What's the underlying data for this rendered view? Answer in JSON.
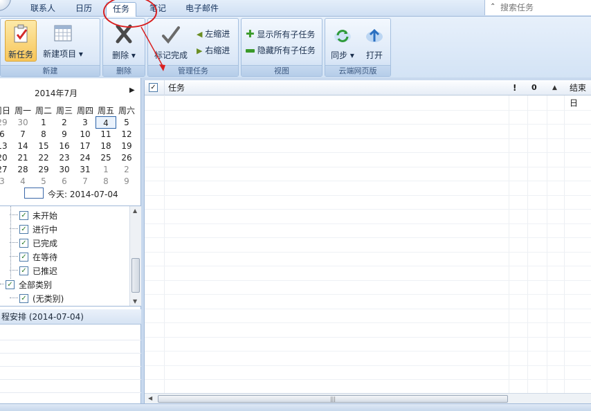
{
  "tabs": [
    "联系人",
    "日历",
    "任务",
    "笔记",
    "电子邮件"
  ],
  "active_tab": "任务",
  "search": {
    "placeholder": "搜索任务"
  },
  "ribbon": {
    "new_task": "新任务",
    "new_item": "新建项目 ▾",
    "delete": "删除 ▾",
    "mark_complete": "标记完成",
    "outdent": "左缩进",
    "indent": "右缩进",
    "show_subtasks": "显示所有子任务",
    "hide_subtasks": "隐藏所有子任务",
    "sync": "同步 ▾",
    "open": "打开",
    "groups": {
      "new": "新建",
      "delete": "删除",
      "manage": "管理任务",
      "view": "视图",
      "cloud": "云端网页版"
    }
  },
  "calendar": {
    "title": "2014年7月",
    "weekdays": [
      "周日",
      "周一",
      "周二",
      "周三",
      "周四",
      "周五",
      "周六"
    ],
    "weeks": [
      [
        "29",
        "30",
        "1",
        "2",
        "3",
        "4",
        "5"
      ],
      [
        "6",
        "7",
        "8",
        "9",
        "10",
        "11",
        "12"
      ],
      [
        "13",
        "14",
        "15",
        "16",
        "17",
        "18",
        "19"
      ],
      [
        "20",
        "21",
        "22",
        "23",
        "24",
        "25",
        "26"
      ],
      [
        "27",
        "28",
        "29",
        "30",
        "31",
        "1",
        "2"
      ],
      [
        "3",
        "4",
        "5",
        "6",
        "7",
        "8",
        "9"
      ]
    ],
    "selected": "4",
    "today_label": "今天: 2014-07-04"
  },
  "tree": {
    "items": [
      {
        "label": "未开始",
        "indent": 1,
        "checked": true
      },
      {
        "label": "进行中",
        "indent": 1,
        "checked": true
      },
      {
        "label": "已完成",
        "indent": 1,
        "checked": true
      },
      {
        "label": "在等待",
        "indent": 1,
        "checked": true
      },
      {
        "label": "已推迟",
        "indent": 1,
        "checked": true
      },
      {
        "label": "全部类别",
        "indent": 0,
        "checked": true
      },
      {
        "label": "(无类别)",
        "indent": 1,
        "checked": true
      }
    ]
  },
  "schedule": {
    "header": "程安排 (2014-07-04)"
  },
  "tasklist": {
    "col_task": "任务",
    "col_priority": "!",
    "col_attach": "0",
    "col_sort": "▲",
    "col_due": "结束日"
  },
  "colors": {
    "accent_red": "#d92020",
    "ribbon_blue": "#c9dbf1"
  }
}
